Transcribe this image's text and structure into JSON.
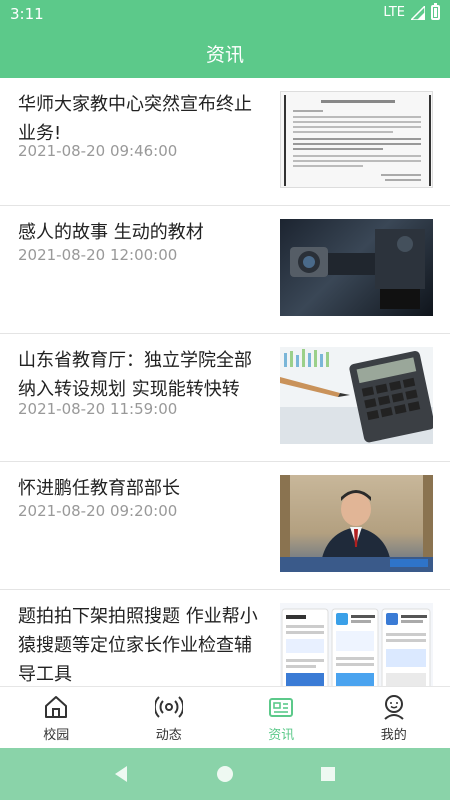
{
  "status_bar": {
    "time": "3:11",
    "network": "LTE"
  },
  "app_bar": {
    "title": "资讯"
  },
  "news": [
    {
      "title": "华师大家教中心突然宣布终止业务!",
      "time": "2021-08-20 09:46:00",
      "thumb": "document-image"
    },
    {
      "title": "感人的故事 生动的教材",
      "time": "2021-08-20 12:00:00",
      "thumb": "camera-image"
    },
    {
      "title": "山东省教育厅：独立学院全部纳入转设规划 实现能转快转",
      "time": "2021-08-20 11:59:00",
      "thumb": "calculator-image"
    },
    {
      "title": "怀进鹏任教育部部长",
      "time": "2021-08-20 09:20:00",
      "thumb": "official-image"
    },
    {
      "title": "题拍拍下架拍照搜题 作业帮小猿搜题等定位家长作业检查辅导工具",
      "time": "",
      "thumb": "app-screenshot-image"
    }
  ],
  "bottom_nav": [
    {
      "label": "校园",
      "icon": "house-icon",
      "active": false
    },
    {
      "label": "动态",
      "icon": "broadcast-icon",
      "active": false
    },
    {
      "label": "资讯",
      "icon": "news-icon",
      "active": true
    },
    {
      "label": "我的",
      "icon": "person-icon",
      "active": false
    }
  ],
  "colors": {
    "accent": "#5cc98a",
    "title_text": "#222222",
    "time_text": "#999999"
  }
}
